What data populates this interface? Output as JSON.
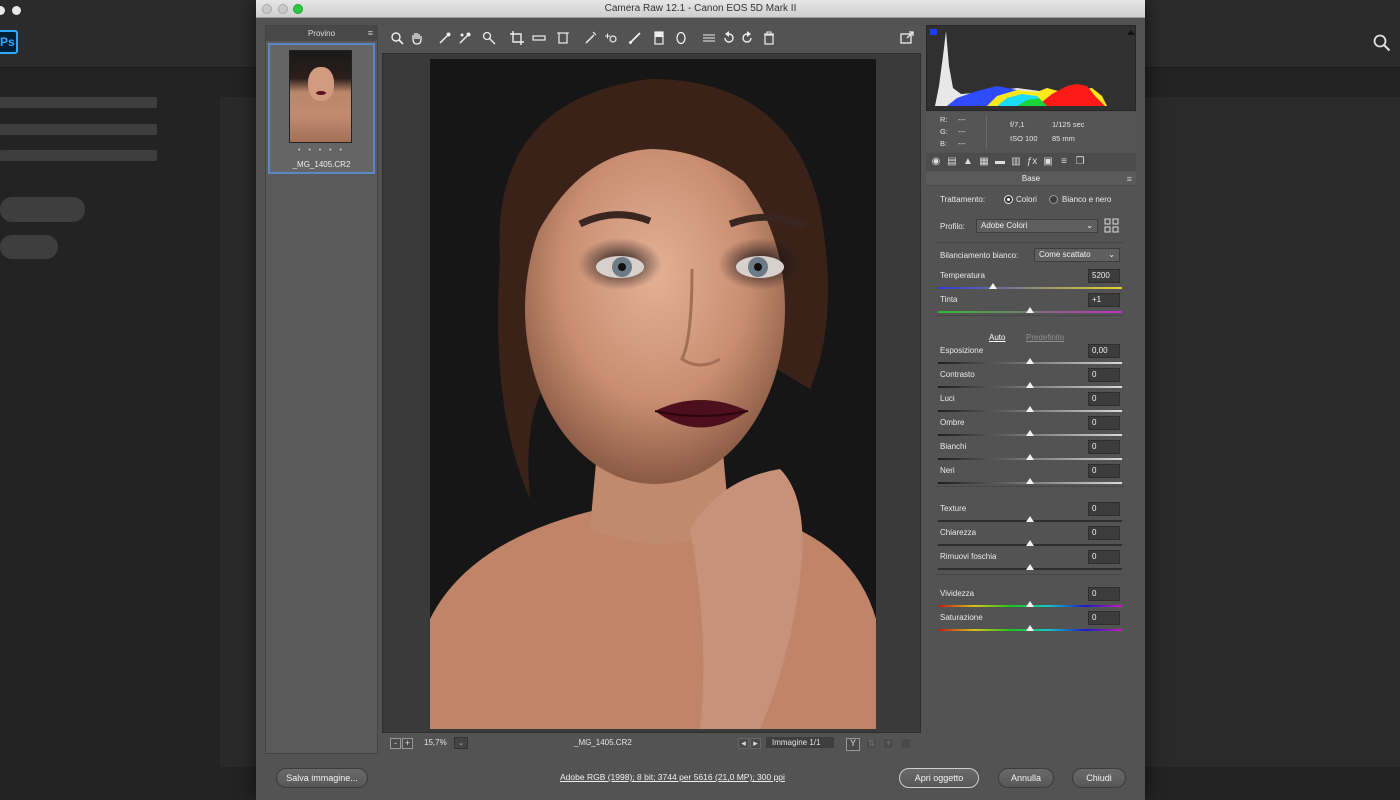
{
  "window": {
    "title": "Camera Raw 12.1  -  Canon EOS 5D Mark II"
  },
  "ps": {
    "logo": "Ps"
  },
  "filmstrip": {
    "header": "Provino",
    "item": {
      "rating": "• • • • •",
      "filename": "_MG_1405.CR2"
    }
  },
  "toolbar": {
    "tools": [
      "zoom-icon",
      "hand-icon",
      "white-balance-icon",
      "color-sampler-icon",
      "target-adjustment-icon",
      "crop-icon",
      "straighten-icon",
      "transform-icon",
      "spot-removal-icon",
      "red-eye-icon",
      "adjustment-brush-icon",
      "graduated-filter-icon",
      "radial-filter-icon",
      "preferences-icon",
      "rotate-left-icon",
      "rotate-right-icon",
      "trash-icon"
    ]
  },
  "status": {
    "zoom": "15,7%",
    "filename": "_MG_1405.CR2",
    "image_counter": "Immagine 1/1"
  },
  "info": {
    "r": "R:",
    "g": "G:",
    "b": "B:",
    "r_val": "---",
    "g_val": "---",
    "b_val": "---",
    "aperture": "f/7,1",
    "shutter": "1/125 sec",
    "iso": "ISO 100",
    "focal": "85 mm"
  },
  "panel": {
    "title": "Base",
    "treatment_label": "Trattamento:",
    "treatment_color": "Colori",
    "treatment_bw": "Bianco e nero",
    "profile_label": "Profilo:",
    "profile_value": "Adobe Colori",
    "wb_label": "Bilanciamento bianco:",
    "wb_value": "Come scattato",
    "auto_label": "Auto",
    "default_label": "Predefinito",
    "sliders": [
      {
        "label": "Temperatura",
        "value": "5200",
        "pos": 0.3
      },
      {
        "label": "Tinta",
        "value": "+1",
        "pos": 0.5
      },
      {
        "label": "Esposizione",
        "value": "0,00",
        "pos": 0.5
      },
      {
        "label": "Contrasto",
        "value": "0",
        "pos": 0.5
      },
      {
        "label": "Luci",
        "value": "0",
        "pos": 0.5
      },
      {
        "label": "Ombre",
        "value": "0",
        "pos": 0.5
      },
      {
        "label": "Bianchi",
        "value": "0",
        "pos": 0.5
      },
      {
        "label": "Neri",
        "value": "0",
        "pos": 0.5
      },
      {
        "label": "Texture",
        "value": "0",
        "pos": 0.5
      },
      {
        "label": "Chiarezza",
        "value": "0",
        "pos": 0.5
      },
      {
        "label": "Rimuovi foschia",
        "value": "0",
        "pos": 0.5
      },
      {
        "label": "Vividezza",
        "value": "0",
        "pos": 0.5
      },
      {
        "label": "Saturazione",
        "value": "0",
        "pos": 0.5
      }
    ]
  },
  "bottom": {
    "save_label": "Salva immagine...",
    "workflow_link": "Adobe RGB (1998); 8 bit; 3744 per 5616 (21,0 MP); 300 ppi",
    "open_label": "Apri oggetto",
    "cancel_label": "Annulla",
    "close_label": "Chiudi"
  }
}
